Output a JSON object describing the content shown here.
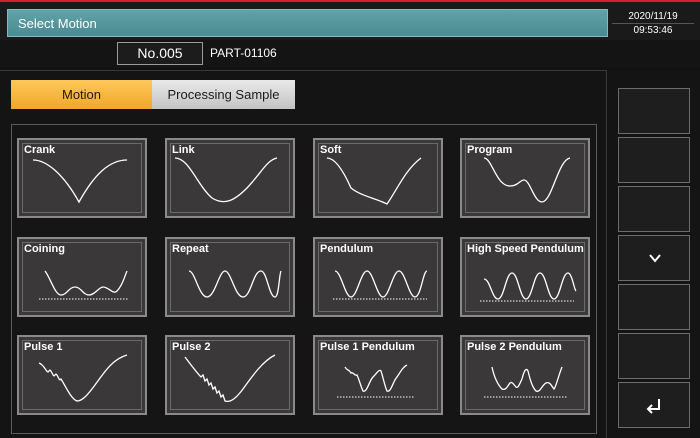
{
  "header": {
    "title": "Select Motion",
    "date": "2020/11/19",
    "time": "09:53:46"
  },
  "info": {
    "program_no": "No.005",
    "part_no": "PART-01106"
  },
  "tabs": [
    {
      "label": "Motion",
      "active": true
    },
    {
      "label": "Processing Sample",
      "active": false
    }
  ],
  "motions": [
    {
      "label": "Crank"
    },
    {
      "label": "Link"
    },
    {
      "label": "Soft"
    },
    {
      "label": "Program"
    },
    {
      "label": "Coining"
    },
    {
      "label": "Repeat"
    },
    {
      "label": "Pendulum"
    },
    {
      "label": "High Speed Pendulum"
    },
    {
      "label": "Pulse 1"
    },
    {
      "label": "Pulse 2"
    },
    {
      "label": "Pulse 1 Pendulum"
    },
    {
      "label": "Pulse 2 Pendulum"
    }
  ],
  "sidebar": {
    "icons": [
      "blank",
      "blank",
      "blank",
      "chevron-down-icon",
      "blank",
      "blank",
      "return-icon"
    ]
  },
  "colors": {
    "active_tab": "#f5b338",
    "title_bar": "#56979d",
    "accent_line": "#cc2233"
  }
}
